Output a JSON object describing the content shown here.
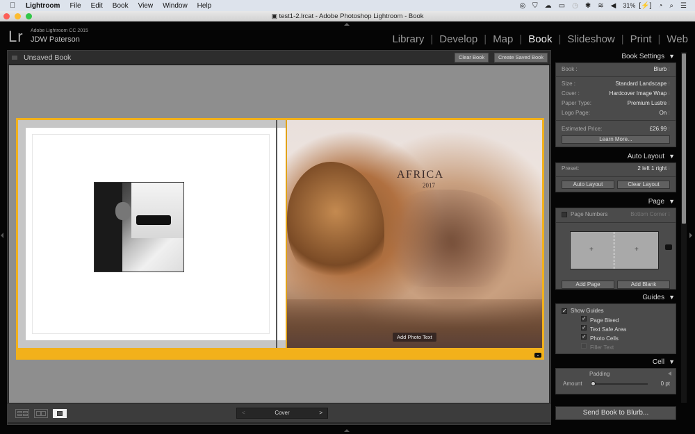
{
  "menubar": {
    "app_name": "Lightroom",
    "items": [
      "File",
      "Edit",
      "Book",
      "View",
      "Window",
      "Help"
    ],
    "status_icons": [
      "creative-cloud-icon",
      "shield-icon",
      "cloud-icon",
      "airplay-icon",
      "time-machine-icon",
      "bluetooth-icon",
      "wifi-icon",
      "volume-icon"
    ],
    "battery": "31%",
    "clock_icon": "clock-icon",
    "search_icon": "spotlight-icon",
    "list_icon": "notification-list-icon"
  },
  "window": {
    "title": "test1-2.lrcat - Adobe Photoshop Lightroom - Book",
    "traffic_lights": {
      "close": "#fc5f57",
      "minimize": "#fdbc2e",
      "maximize": "#33c748"
    }
  },
  "identity": {
    "logo": "Lr",
    "product": "Adobe Lightroom CC 2015",
    "user": "JDW Paterson"
  },
  "modules": {
    "items": [
      "Library",
      "Develop",
      "Map",
      "Book",
      "Slideshow",
      "Print",
      "Web"
    ],
    "active": "Book"
  },
  "book_header": {
    "title": "Unsaved Book",
    "clear_label": "Clear Book",
    "create_label": "Create Saved Book"
  },
  "spread": {
    "accent_color": "#f2b11b",
    "cover_title": "Africa",
    "cover_year": "2017",
    "photo_text_label": "Add Photo Text"
  },
  "toolbar": {
    "view_modes": [
      "multi-page-view",
      "spread-view",
      "single-page-view"
    ],
    "selected_view": "single-page-view",
    "page_label": "Cover"
  },
  "panels": {
    "book_settings": {
      "title": "Book Settings",
      "book_label": "Book :",
      "book_value": "Blurb",
      "size_label": "Size :",
      "size_value": "Standard Landscape",
      "cover_label": "Cover :",
      "cover_value": "Hardcover Image Wrap",
      "paper_label": "Paper Type:",
      "paper_value": "Premium Lustre",
      "logo_label": "Logo Page:",
      "logo_value": "On",
      "price_label": "Estimated Price:",
      "price_value": "£26.99",
      "learn_more": "Learn More..."
    },
    "auto_layout": {
      "title": "Auto Layout",
      "preset_label": "Preset:",
      "preset_value": "2 left 1 right",
      "auto_btn": "Auto Layout",
      "clear_btn": "Clear Layout"
    },
    "page": {
      "title": "Page",
      "page_numbers_label": "Page Numbers",
      "page_numbers_checked": false,
      "page_numbers_position": "Bottom Corner",
      "add_page_btn": "Add Page",
      "add_blank_btn": "Add Blank"
    },
    "guides": {
      "title": "Guides",
      "show_guides_label": "Show Guides",
      "show_guides": true,
      "items": [
        {
          "label": "Page Bleed",
          "checked": true
        },
        {
          "label": "Text Safe Area",
          "checked": true
        },
        {
          "label": "Photo Cells",
          "checked": true
        },
        {
          "label": "Filler Text",
          "checked": false
        }
      ]
    },
    "cell": {
      "title": "Cell",
      "padding_label": "Padding",
      "amount_label": "Amount",
      "amount_value": "0 pt",
      "amount_fraction": 0
    },
    "send_btn": "Send Book to Blurb..."
  }
}
